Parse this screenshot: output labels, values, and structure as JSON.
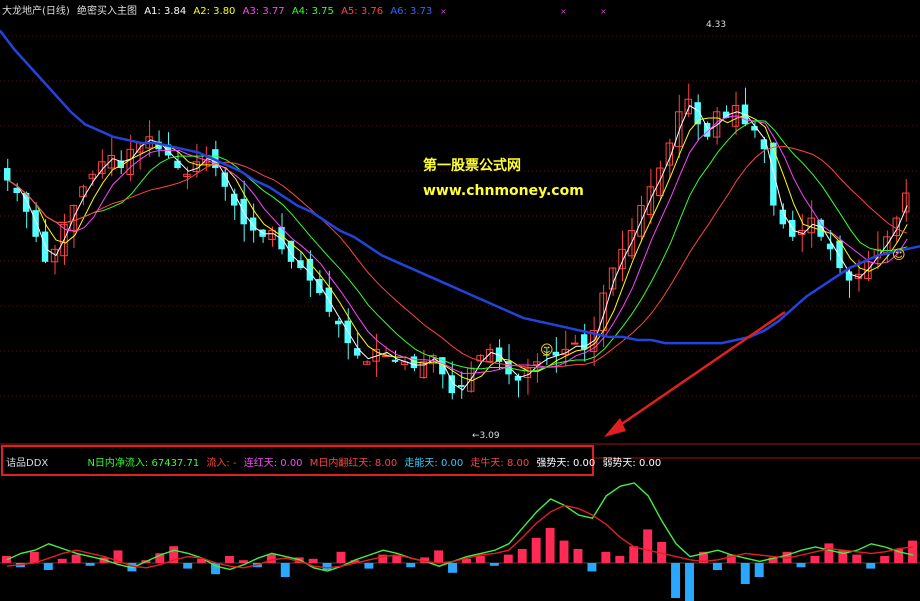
{
  "header": {
    "title": "大龙地产(日线)",
    "indicator_name": "绝密买入主图",
    "items": [
      {
        "label": "A1: 3.84",
        "color": "#ffffff"
      },
      {
        "label": "A2: 3.80",
        "color": "#ffff00"
      },
      {
        "label": "A3: 3.77",
        "color": "#ff44ff"
      },
      {
        "label": "A4: 3.75",
        "color": "#33ff33"
      },
      {
        "label": "A5: 3.76",
        "color": "#ff4444"
      },
      {
        "label": "A6: 3.73",
        "color": "#3366ff"
      }
    ]
  },
  "watermark": {
    "line1": "第一股票公式网",
    "line2": "www.chnmoney.com"
  },
  "labels": {
    "high": "4.33",
    "low": "←3.09"
  },
  "indicator": {
    "name": "诘品DDX",
    "items": [
      {
        "label": "N日内净流入: 67437.71",
        "color": "#33ff33"
      },
      {
        "label": "流入: -",
        "color": "#ff4444"
      },
      {
        "label": "连红天: 0.00",
        "color": "#ff44ff"
      },
      {
        "label": "M日内翻红天: 8.00",
        "color": "#ff4444"
      },
      {
        "label": "走能天: 0.00",
        "color": "#33ccff"
      },
      {
        "label": "走牛天: 8.00",
        "color": "#ff4444"
      },
      {
        "label": "强势天: 0.00",
        "color": "#ffffff"
      },
      {
        "label": "弱势天: 0.00",
        "color": "#ffffff"
      }
    ]
  },
  "chart_data": {
    "type": "candlestick",
    "price_range": [
      3.05,
      4.4
    ],
    "closes": [
      3.88,
      3.84,
      3.78,
      3.7,
      3.62,
      3.66,
      3.74,
      3.8,
      3.86,
      3.9,
      3.94,
      3.96,
      3.92,
      3.98,
      4.0,
      4.02,
      3.98,
      3.96,
      3.92,
      3.9,
      3.94,
      3.96,
      3.92,
      3.86,
      3.8,
      3.74,
      3.72,
      3.7,
      3.72,
      3.66,
      3.62,
      3.6,
      3.56,
      3.52,
      3.46,
      3.42,
      3.36,
      3.32,
      3.3,
      3.34,
      3.32,
      3.3,
      3.3,
      3.28,
      3.3,
      3.32,
      3.26,
      3.2,
      3.22,
      3.28,
      3.32,
      3.34,
      3.3,
      3.26,
      3.24,
      3.28,
      3.3,
      3.32,
      3.32,
      3.34,
      3.36,
      3.34,
      3.4,
      3.52,
      3.6,
      3.66,
      3.72,
      3.8,
      3.86,
      3.92,
      4.0,
      4.1,
      4.14,
      4.06,
      4.02,
      4.1,
      4.08,
      4.12,
      4.06,
      4.04,
      3.98,
      3.8,
      3.74,
      3.7,
      3.72,
      3.76,
      3.7,
      3.66,
      3.6,
      3.56,
      3.58,
      3.62,
      3.66,
      3.7,
      3.76,
      3.84
    ],
    "ma_long": [
      4.36,
      4.3,
      4.25,
      4.2,
      4.15,
      4.1,
      4.06,
      4.04,
      4.02,
      4.01,
      4.0,
      4.0,
      3.99,
      3.98,
      3.97,
      3.95,
      3.93,
      3.91,
      3.88,
      3.86,
      3.83,
      3.8,
      3.78,
      3.75,
      3.72,
      3.7,
      3.67,
      3.64,
      3.62,
      3.6,
      3.58,
      3.56,
      3.54,
      3.52,
      3.5,
      3.48,
      3.46,
      3.44,
      3.43,
      3.42,
      3.41,
      3.4,
      3.39,
      3.38,
      3.38,
      3.37,
      3.37,
      3.36,
      3.36,
      3.36,
      3.36,
      3.36,
      3.37,
      3.38,
      3.4,
      3.43,
      3.47,
      3.51,
      3.54,
      3.57,
      3.6,
      3.62,
      3.64,
      3.65,
      3.66,
      3.67
    ],
    "ddx_bars": [
      0.5,
      -0.3,
      0.8,
      -0.5,
      0.3,
      0.6,
      -0.2,
      0.4,
      0.9,
      -0.6,
      0.2,
      0.7,
      1.2,
      -0.4,
      0.3,
      -0.8,
      0.5,
      0.2,
      -0.3,
      0.6,
      -1.0,
      0.4,
      0.3,
      -0.5,
      0.8,
      0.2,
      -0.4,
      0.6,
      0.5,
      -0.3,
      0.4,
      0.9,
      -0.7,
      0.3,
      0.5,
      -0.2,
      0.6,
      1.0,
      1.8,
      2.5,
      1.6,
      1.0,
      -0.6,
      0.8,
      0.5,
      1.2,
      2.4,
      1.5,
      -2.5,
      -3.0,
      0.8,
      -0.5,
      0.6,
      -1.5,
      -1.0,
      0.4,
      0.8,
      -0.3,
      0.5,
      1.4,
      0.9,
      0.6,
      -0.4,
      0.5,
      1.0,
      1.6
    ],
    "ddx_green": [
      0.2,
      0.6,
      0.8,
      1.2,
      0.9,
      0.6,
      0.4,
      0.2,
      -0.1,
      -0.3,
      0.1,
      0.5,
      0.8,
      0.6,
      0.3,
      -0.2,
      -0.4,
      -0.1,
      0.3,
      0.6,
      0.4,
      0.2,
      -0.3,
      -0.5,
      -0.2,
      0.2,
      0.5,
      0.8,
      0.6,
      0.3,
      0.1,
      -0.2,
      0.1,
      0.4,
      0.6,
      0.8,
      1.2,
      2.2,
      3.2,
      4.0,
      3.6,
      3.0,
      2.8,
      4.2,
      4.8,
      5.0,
      4.2,
      2.6,
      1.2,
      0.4,
      0.6,
      0.8,
      0.5,
      0.3,
      0.1,
      0.3,
      0.5,
      0.8,
      1.0,
      0.8,
      0.6,
      0.8,
      1.2,
      1.0,
      0.7,
      0.5
    ],
    "ddx_red": [
      -0.2,
      -0.1,
      0.0,
      0.3,
      0.6,
      0.8,
      0.6,
      0.4,
      0.1,
      -0.2,
      -0.3,
      -0.1,
      0.2,
      0.4,
      0.3,
      0.0,
      -0.2,
      -0.3,
      -0.1,
      0.2,
      0.3,
      0.1,
      -0.2,
      -0.3,
      -0.2,
      0.0,
      0.2,
      0.4,
      0.5,
      0.3,
      0.1,
      0.0,
      0.1,
      0.3,
      0.5,
      0.6,
      0.8,
      1.6,
      2.5,
      3.2,
      3.6,
      3.4,
      3.0,
      2.4,
      1.6,
      1.0,
      0.8,
      0.6,
      0.4,
      0.2,
      0.1,
      0.2,
      0.4,
      0.6,
      0.5,
      0.4,
      0.3,
      0.5,
      0.7,
      0.9,
      0.8,
      0.7,
      0.6,
      0.7,
      0.9,
      1.0
    ]
  }
}
